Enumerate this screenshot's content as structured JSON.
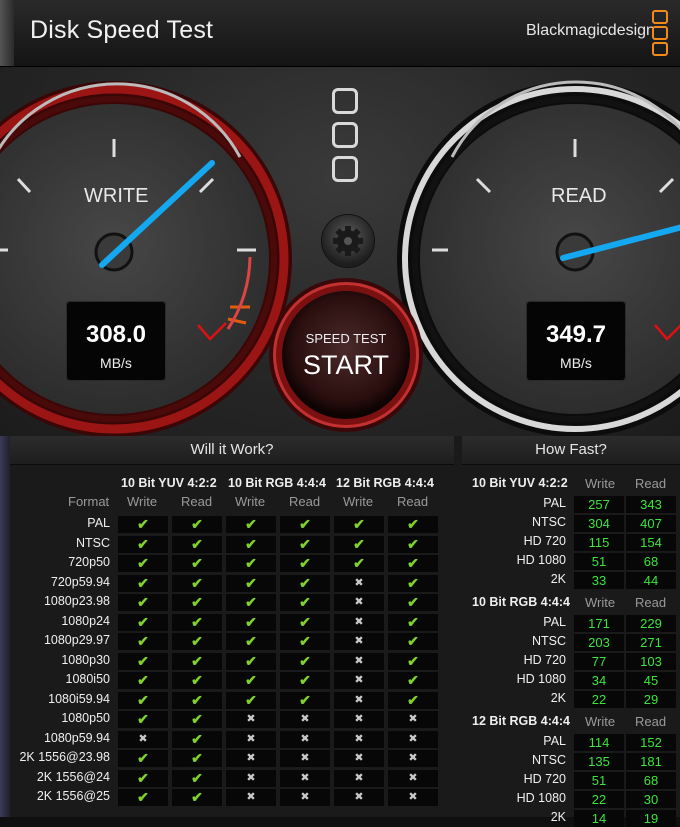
{
  "app": {
    "title": "Disk Speed Test",
    "brand": "Blackmagicdesign"
  },
  "gauges": {
    "write": {
      "label": "WRITE",
      "value": "308.0",
      "unit": "MB/s"
    },
    "read": {
      "label": "READ",
      "value": "349.7",
      "unit": "MB/s"
    }
  },
  "start_button": {
    "line1": "SPEED TEST",
    "line2": "START"
  },
  "will_it_work": {
    "title": "Will it Work?",
    "format_header": "Format",
    "groups": [
      "10 Bit YUV 4:2:2",
      "10 Bit RGB 4:4:4",
      "12 Bit RGB 4:4:4"
    ],
    "subheaders": [
      "Write",
      "Read"
    ],
    "rows": [
      {
        "format": "PAL",
        "cells": [
          1,
          1,
          1,
          1,
          1,
          1
        ]
      },
      {
        "format": "NTSC",
        "cells": [
          1,
          1,
          1,
          1,
          1,
          1
        ]
      },
      {
        "format": "720p50",
        "cells": [
          1,
          1,
          1,
          1,
          1,
          1
        ]
      },
      {
        "format": "720p59.94",
        "cells": [
          1,
          1,
          1,
          1,
          0,
          1
        ]
      },
      {
        "format": "1080p23.98",
        "cells": [
          1,
          1,
          1,
          1,
          0,
          1
        ]
      },
      {
        "format": "1080p24",
        "cells": [
          1,
          1,
          1,
          1,
          0,
          1
        ]
      },
      {
        "format": "1080p29.97",
        "cells": [
          1,
          1,
          1,
          1,
          0,
          1
        ]
      },
      {
        "format": "1080p30",
        "cells": [
          1,
          1,
          1,
          1,
          0,
          1
        ]
      },
      {
        "format": "1080i50",
        "cells": [
          1,
          1,
          1,
          1,
          0,
          1
        ]
      },
      {
        "format": "1080i59.94",
        "cells": [
          1,
          1,
          1,
          1,
          0,
          1
        ]
      },
      {
        "format": "1080p50",
        "cells": [
          1,
          1,
          0,
          0,
          0,
          0
        ]
      },
      {
        "format": "1080p59.94",
        "cells": [
          0,
          1,
          0,
          0,
          0,
          0
        ]
      },
      {
        "format": "2K 1556@23.98",
        "cells": [
          1,
          1,
          0,
          0,
          0,
          0
        ]
      },
      {
        "format": "2K 1556@24",
        "cells": [
          1,
          1,
          0,
          0,
          0,
          0
        ]
      },
      {
        "format": "2K 1556@25",
        "cells": [
          1,
          1,
          0,
          0,
          0,
          0
        ]
      }
    ]
  },
  "how_fast": {
    "title": "How Fast?",
    "subheaders": [
      "Write",
      "Read"
    ],
    "groups": [
      {
        "name": "10 Bit YUV 4:2:2",
        "rows": [
          {
            "format": "PAL",
            "write": "257",
            "read": "343"
          },
          {
            "format": "NTSC",
            "write": "304",
            "read": "407"
          },
          {
            "format": "HD 720",
            "write": "115",
            "read": "154"
          },
          {
            "format": "HD 1080",
            "write": "51",
            "read": "68"
          },
          {
            "format": "2K",
            "write": "33",
            "read": "44"
          }
        ]
      },
      {
        "name": "10 Bit RGB 4:4:4",
        "rows": [
          {
            "format": "PAL",
            "write": "171",
            "read": "229"
          },
          {
            "format": "NTSC",
            "write": "203",
            "read": "271"
          },
          {
            "format": "HD 720",
            "write": "77",
            "read": "103"
          },
          {
            "format": "HD 1080",
            "write": "34",
            "read": "45"
          },
          {
            "format": "2K",
            "write": "22",
            "read": "29"
          }
        ]
      },
      {
        "name": "12 Bit RGB 4:4:4",
        "rows": [
          {
            "format": "PAL",
            "write": "114",
            "read": "152"
          },
          {
            "format": "NTSC",
            "write": "135",
            "read": "181"
          },
          {
            "format": "HD 720",
            "write": "51",
            "read": "68"
          },
          {
            "format": "HD 1080",
            "write": "22",
            "read": "30"
          },
          {
            "format": "2K",
            "write": "14",
            "read": "19"
          }
        ]
      }
    ]
  }
}
